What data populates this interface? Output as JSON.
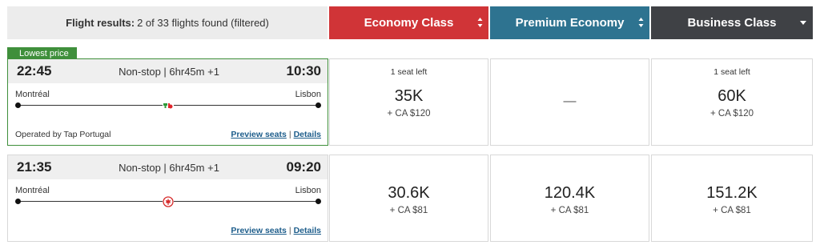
{
  "header": {
    "summary_label": "Flight results:",
    "summary_text": "2 of 33 flights found (filtered)",
    "tabs": [
      {
        "label": "Economy Class",
        "color": "#d03437",
        "icon": "sort-icon"
      },
      {
        "label": "Premium Economy",
        "color": "#2e7390",
        "icon": "sort-icon"
      },
      {
        "label": "Business Class",
        "color": "#3f4145",
        "icon": "caret-down-icon"
      }
    ]
  },
  "badge": {
    "label": "Lowest price",
    "color": "#3f8f3b"
  },
  "flights": [
    {
      "depart": "22:45",
      "summary": "Non-stop | 6hr45m +1",
      "arrive": "10:30",
      "origin": "Montréal",
      "destination": "Lisbon",
      "airline_icon": "tap-portugal-logo",
      "operated_by": "Operated by Tap Portugal",
      "preview_seats": "Preview seats",
      "separator": "|",
      "details": "Details",
      "fares": {
        "economy": {
          "seats_left": "1 seat left",
          "points": "35K",
          "cash": "+ CA $120"
        },
        "premium": {
          "unavailable": "—"
        },
        "business": {
          "seats_left": "1 seat left",
          "points": "60K",
          "cash": "+ CA $120"
        }
      }
    },
    {
      "depart": "21:35",
      "summary": "Non-stop | 6hr45m +1",
      "arrive": "09:20",
      "origin": "Montréal",
      "destination": "Lisbon",
      "airline_icon": "air-canada-logo",
      "preview_seats": "Preview seats",
      "separator": "|",
      "details": "Details",
      "fares": {
        "economy": {
          "points": "30.6K",
          "cash": "+ CA $81"
        },
        "premium": {
          "points": "120.4K",
          "cash": "+ CA $81"
        },
        "business": {
          "points": "151.2K",
          "cash": "+ CA $81"
        }
      }
    }
  ]
}
